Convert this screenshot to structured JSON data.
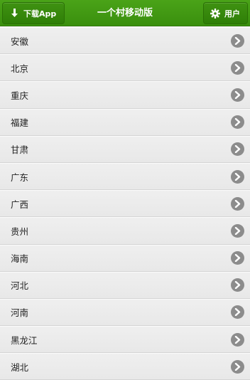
{
  "header": {
    "download_label": "下载App",
    "title": "一个村移动版",
    "user_label": "用户"
  },
  "provinces": [
    "安徽",
    "北京",
    "重庆",
    "福建",
    "甘肃",
    "广东",
    "广西",
    "贵州",
    "海南",
    "河北",
    "河南",
    "黑龙江",
    "湖北"
  ],
  "colors": {
    "header": "#3e9812",
    "row_bg": "#ececec",
    "arrow": "#8c8c8c"
  }
}
